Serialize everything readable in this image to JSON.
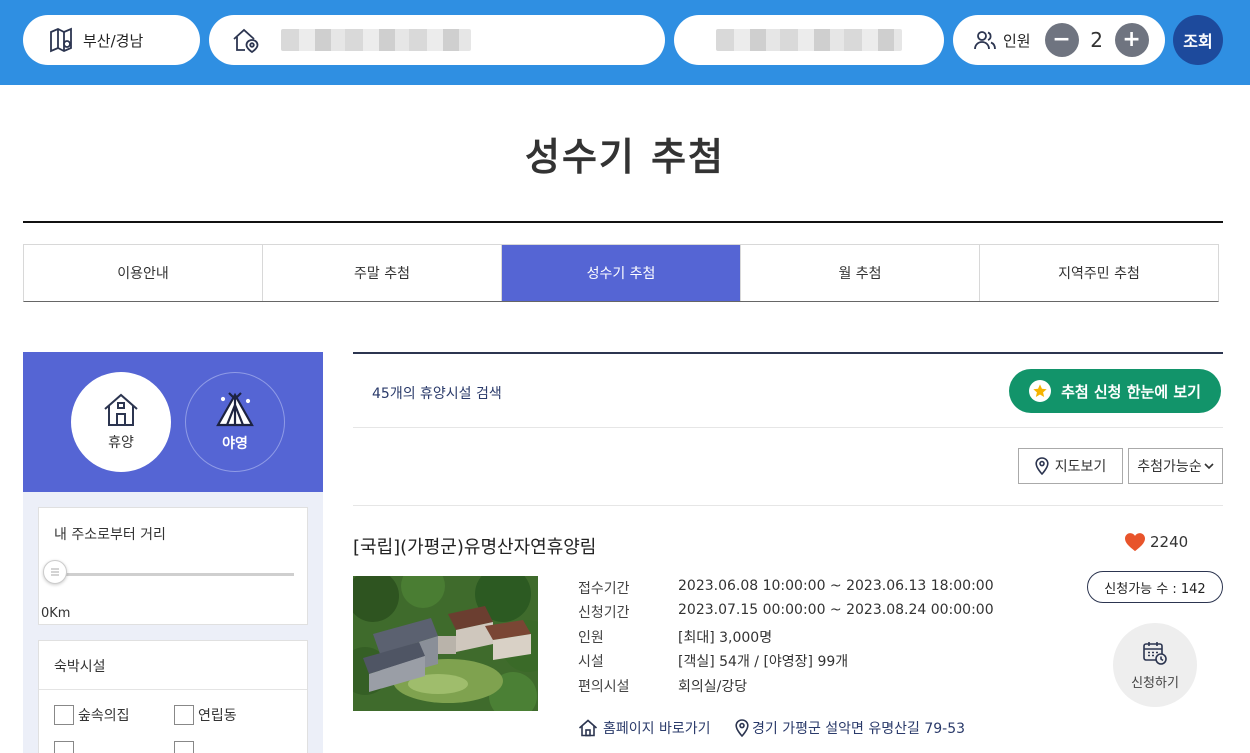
{
  "search": {
    "region": "부산/경남",
    "people_label": "인원",
    "people_count": "2",
    "decrement": "−",
    "increment": "+",
    "search_label": "조회"
  },
  "page": {
    "title": "성수기 추첨"
  },
  "tabs": [
    {
      "label": "이용안내"
    },
    {
      "label": "주말 추첨"
    },
    {
      "label": "성수기 추첨",
      "active": true
    },
    {
      "label": "월 추첨"
    },
    {
      "label": "지역주민 추첨"
    }
  ],
  "sidebar": {
    "type_stay": "휴양",
    "type_camp": "야영",
    "distance_title": "내 주소로부터 거리",
    "distance_value": "0Km",
    "stay_title": "숙박시설",
    "stay_options": [
      "숲속의집",
      "연립동"
    ]
  },
  "results": {
    "count_text": "45개의 휴양시설 검색",
    "all_button": "추첨 신청 한눈에 보기",
    "map_button": "지도보기",
    "sort_selected": "추첨가능순"
  },
  "item": {
    "title": "[국립](가평군)유명산자연휴양림",
    "likes": "2240",
    "fields": [
      {
        "label": "접수기간",
        "value": "2023.06.08 10:00:00 ~ 2023.06.13 18:00:00"
      },
      {
        "label": "신청기간",
        "value": "2023.07.15 00:00:00 ~ 2023.08.24 00:00:00"
      },
      {
        "label": "인원",
        "value": "[최대] 3,000명"
      },
      {
        "label": "시설",
        "value": "[객실] 54개 / [야영장] 99개"
      },
      {
        "label": "편의시설",
        "value": "회의실/강당"
      }
    ],
    "available": "신청가능 수 : 142",
    "apply_label": "신청하기",
    "homepage_link": "홈페이지 바로가기",
    "address": "경기 가평군 설악면 유명산길 79-53"
  },
  "colors": {
    "topbar": "#2f8fe2",
    "accent": "#5565d4",
    "green_button": "#12946a",
    "search_button": "#1d4a9c",
    "heart": "#e8542b"
  }
}
